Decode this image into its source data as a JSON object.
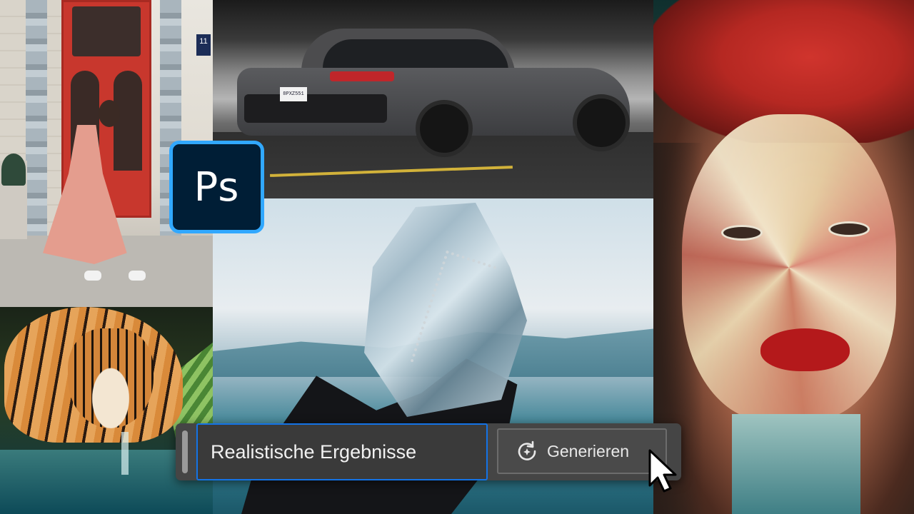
{
  "images": {
    "woman_door": {
      "house_number": "11",
      "description": "woman in pink dress in front of red door"
    },
    "car": {
      "plate": "8PXZ551"
    },
    "painting": {},
    "tiger": {},
    "ice_dinosaur": {}
  },
  "app_logo": {
    "text": "Ps",
    "bg_color": "#001e36",
    "border_color": "#31a8ff"
  },
  "generative_fill": {
    "prompt_value": "Realistische Ergebnisse",
    "generate_label": "Generieren",
    "generate_icon": "generate-sparkle-icon",
    "accent_color": "#1473e6"
  },
  "cursor": {
    "icon": "arrow-cursor"
  }
}
